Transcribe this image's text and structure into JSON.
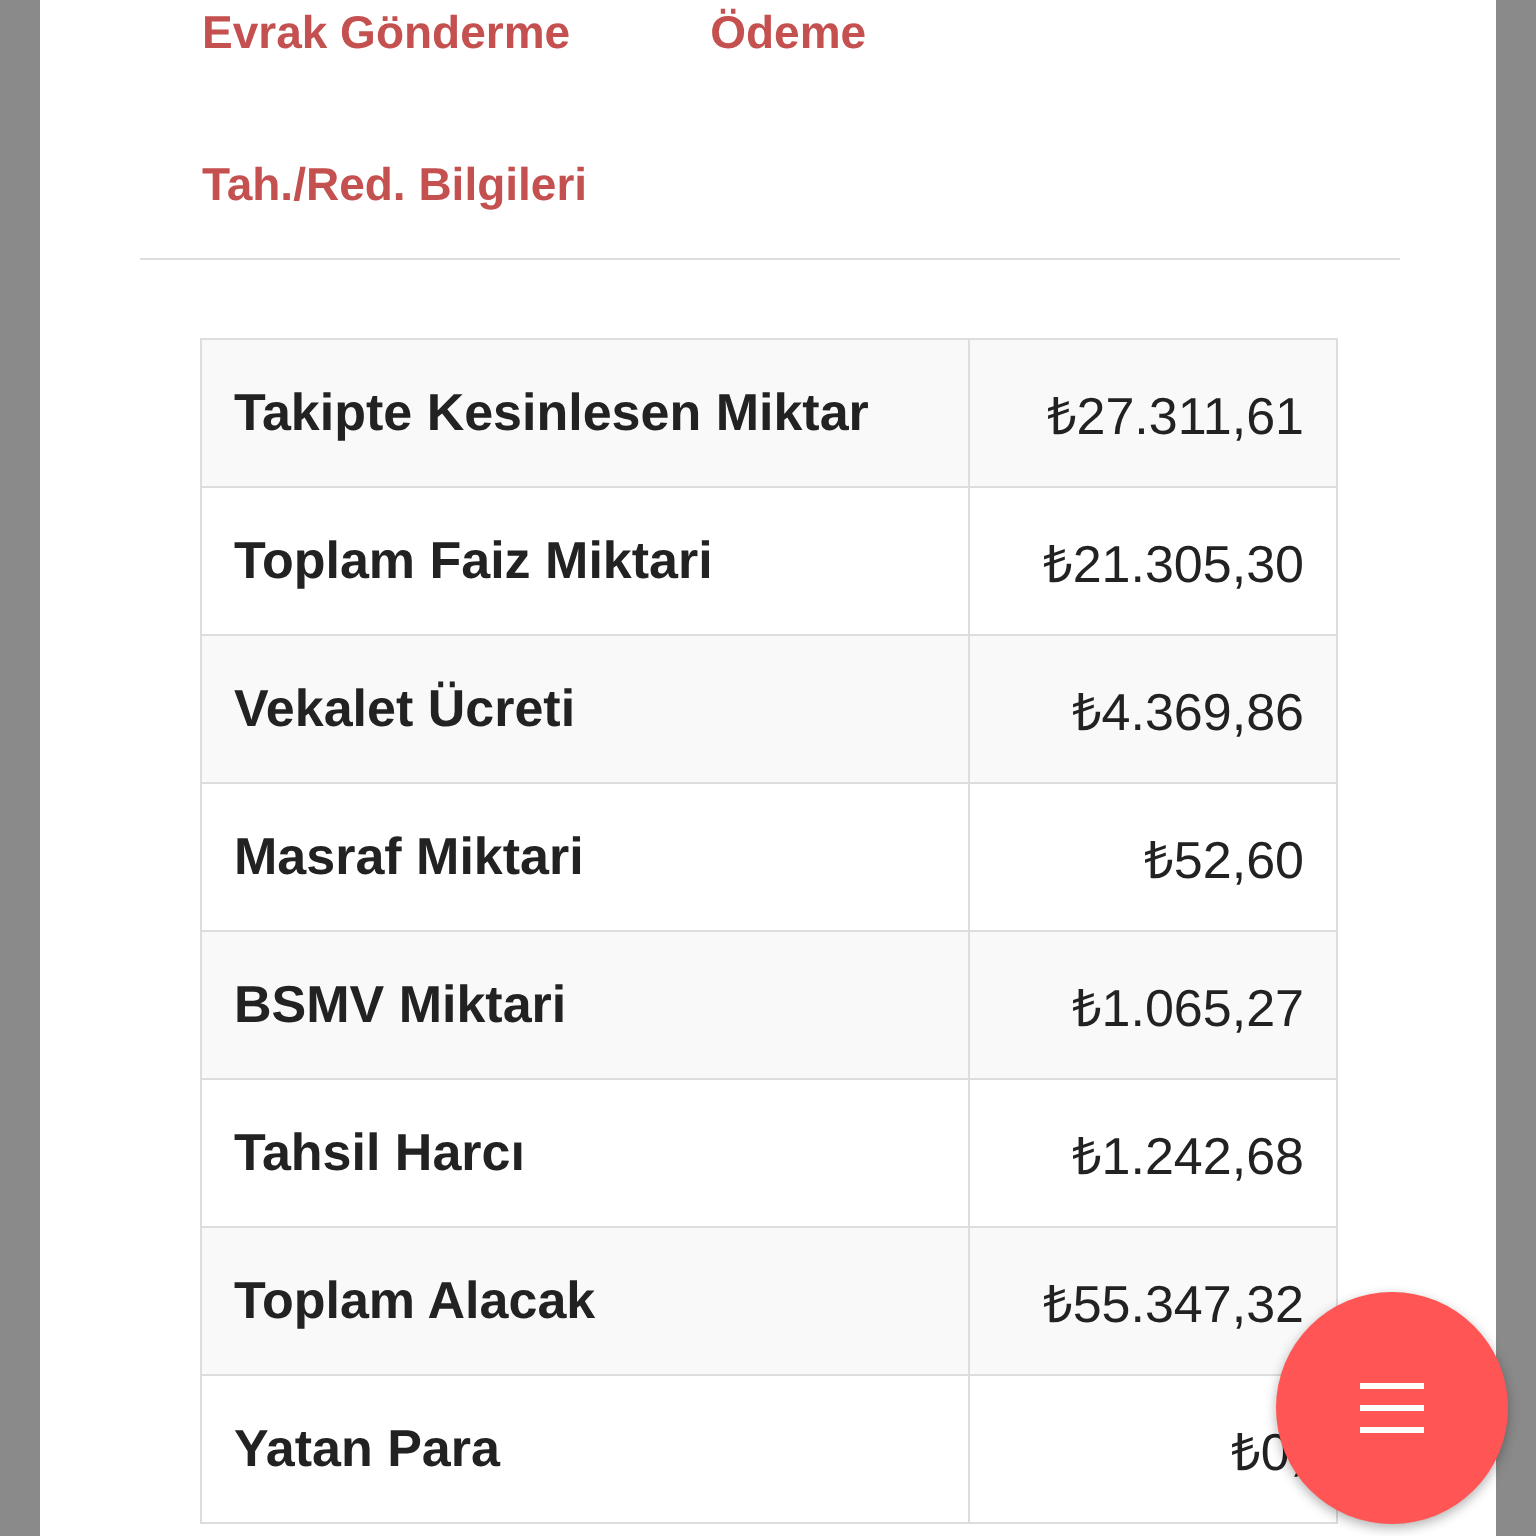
{
  "tabs": [
    {
      "label": "Evrak Gönderme"
    },
    {
      "label": "Ödeme"
    },
    {
      "label": "Tah./Red. Bilgileri"
    }
  ],
  "table": {
    "rows": [
      {
        "label": "Takipte Kesinlesen Miktar",
        "value": "₺27.311,61"
      },
      {
        "label": "Toplam Faiz Miktari",
        "value": "₺21.305,30"
      },
      {
        "label": "Vekalet Ücreti",
        "value": "₺4.369,86"
      },
      {
        "label": "Masraf Miktari",
        "value": "₺52,60"
      },
      {
        "label": "BSMV Miktari",
        "value": "₺1.065,27"
      },
      {
        "label": "Tahsil Harcı",
        "value": "₺1.242,68"
      },
      {
        "label": "Toplam Alacak",
        "value": "₺55.347,32"
      },
      {
        "label": "Yatan Para",
        "value": "₺0,"
      }
    ]
  }
}
